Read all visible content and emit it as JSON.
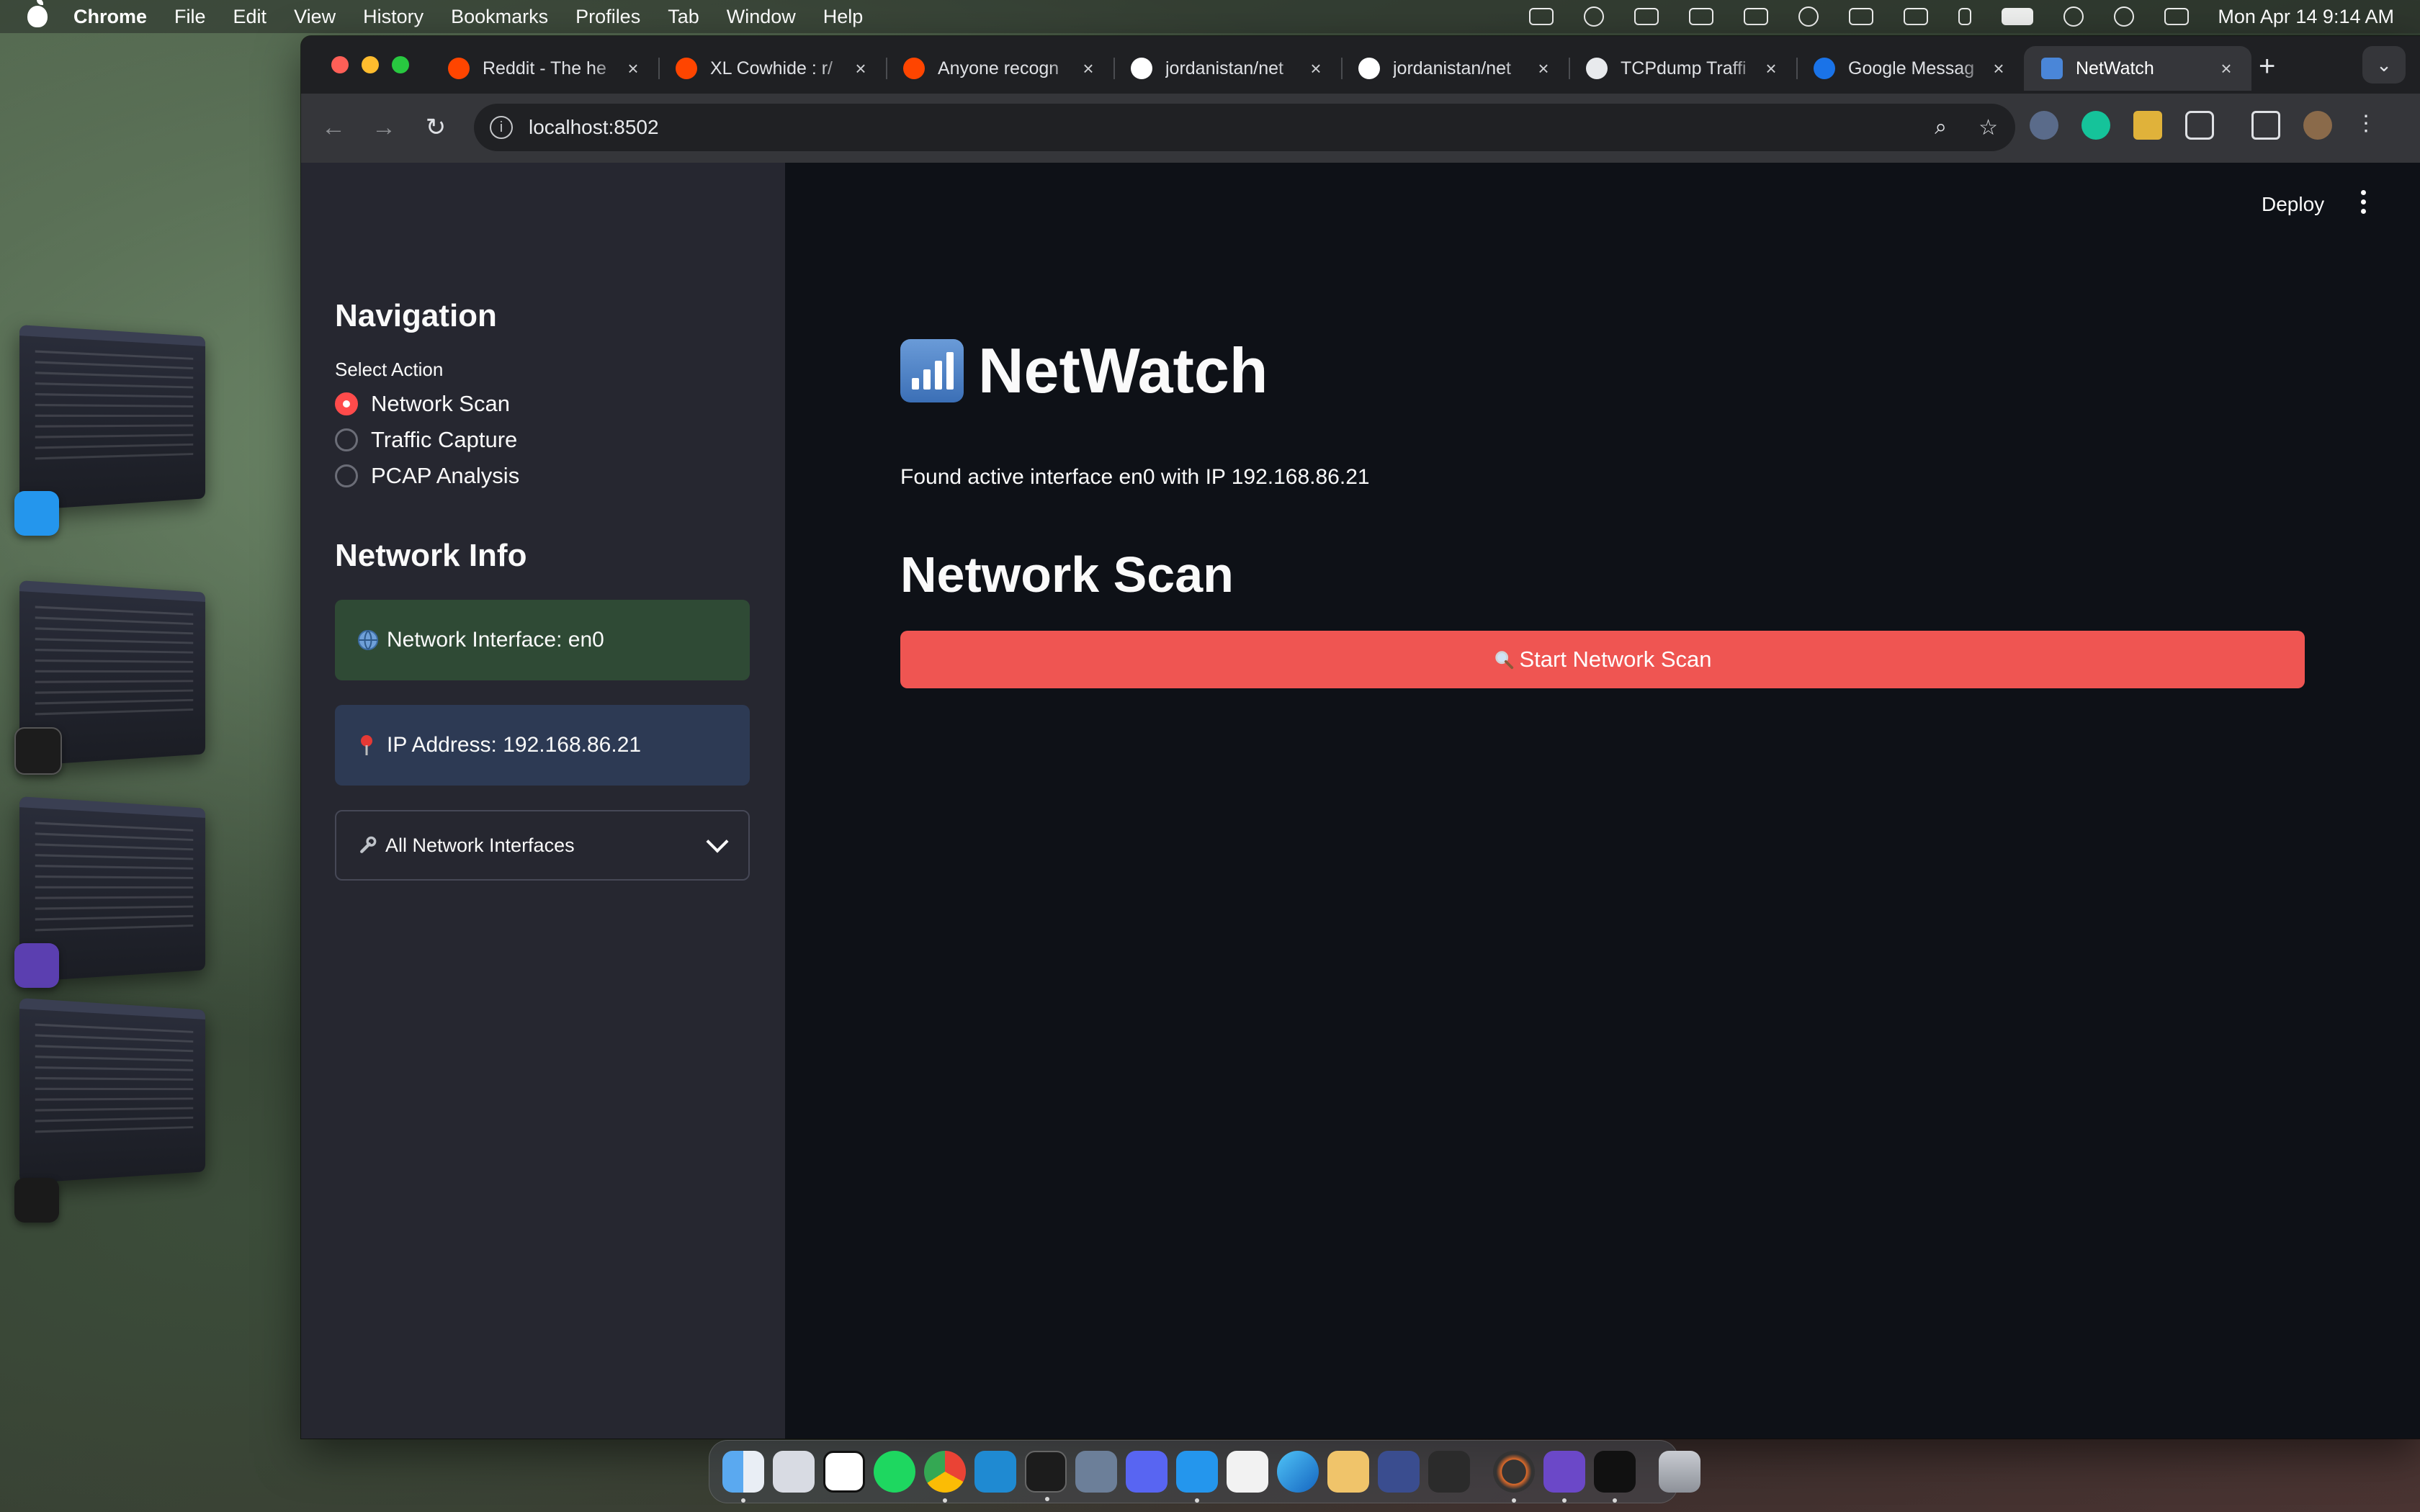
{
  "menubar": {
    "app_name": "Chrome",
    "menus": [
      "File",
      "Edit",
      "View",
      "History",
      "Bookmarks",
      "Profiles",
      "Tab",
      "Window",
      "Help"
    ],
    "clock": "Mon Apr 14  9:14 AM",
    "status_icons": [
      "docker-icon",
      "grammarly-icon",
      "coffee-icon",
      "glasses-icon",
      "battery-meter-icon",
      "time-machine-icon",
      "volume-icon",
      "display-icon",
      "bluetooth-icon",
      "battery-icon",
      "wifi-icon",
      "spotlight-search-icon",
      "control-center-icon"
    ]
  },
  "browser": {
    "tabs": [
      {
        "title": "Reddit - The he",
        "icon": "reddit-icon",
        "color": "#ff4500"
      },
      {
        "title": "XL Cowhide : r/",
        "icon": "reddit-icon",
        "color": "#ff4500"
      },
      {
        "title": "Anyone recogn",
        "icon": "reddit-icon",
        "color": "#ff4500"
      },
      {
        "title": "jordanistan/net",
        "icon": "github-icon",
        "color": "#ffffff"
      },
      {
        "title": "jordanistan/net",
        "icon": "github-icon",
        "color": "#ffffff"
      },
      {
        "title": "TCPdump Traffi",
        "icon": "chatgpt-icon",
        "color": "#e8eaed"
      },
      {
        "title": "Google Messag",
        "icon": "google-messages-icon",
        "color": "#1a73e8"
      },
      {
        "title": "NetWatch",
        "icon": "signal-bars-icon",
        "color": "#4a86d8",
        "active": true
      }
    ],
    "url": "localhost:8502",
    "close_glyph": "×",
    "new_tab_glyph": "+",
    "tab_menu_glyph": "⌄",
    "nav": {
      "back": "←",
      "forward": "→",
      "reload": "↻"
    },
    "omnibox_icons": {
      "zoom": "⌕",
      "bookmark": "☆",
      "info": "i"
    }
  },
  "app": {
    "sidebar": {
      "nav_heading": "Navigation",
      "select_label": "Select Action",
      "options": [
        "Network Scan",
        "Traffic Capture",
        "PCAP Analysis"
      ],
      "selected_index": 0,
      "info_heading": "Network Info",
      "interface_alert": "Network Interface: en0",
      "ip_alert": "IP Address: 192.168.86.21",
      "expander_label": "All Network Interfaces"
    },
    "header": {
      "deploy_label": "Deploy"
    },
    "title": "NetWatch",
    "status_text": "Found active interface en0 with IP 192.168.86.21",
    "section_heading": "Network Scan",
    "scan_button_label": "Start Network Scan",
    "colors": {
      "primary": "#ff4b4b",
      "sidebar_bg": "#262730",
      "main_bg": "#0e1117",
      "success_bg": "#2f4a35",
      "info_bg": "#2d3a54"
    }
  },
  "dock": {
    "apps": [
      "finder-icon",
      "launchpad-icon",
      "notion-icon",
      "spotify-icon",
      "chrome-icon",
      "vscode-icon",
      "terminal-icon",
      "xcode-simulator-icon",
      "discord-icon",
      "docker-icon",
      "ollama-icon",
      "warp-icon",
      "cyberduck-icon",
      "starry-app-icon",
      "grid-app-icon",
      "instruments-icon",
      "obsidian-icon",
      "streamlit-icon",
      "trash-icon"
    ]
  }
}
